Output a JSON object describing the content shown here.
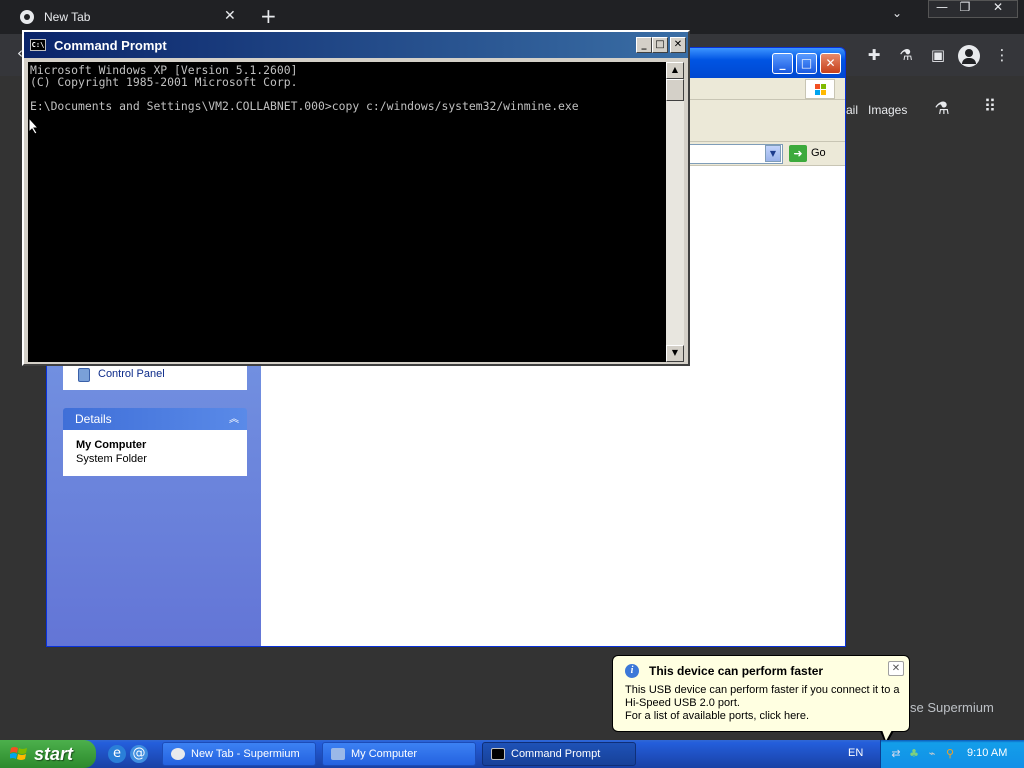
{
  "chrome": {
    "tab_title": "New Tab",
    "tab_close": "✕",
    "new_tab": "+",
    "tab_menu": "⌄",
    "minimize": "—",
    "restore": "❐",
    "close": "✕",
    "toolbar": {
      "gmail_partial": "ail",
      "images": "Images",
      "ext_icon": "puzzle-icon",
      "lab_icon": "flask-icon",
      "sidepanel_icon": "side-panel-icon",
      "profile_icon": "profile-icon",
      "menu_icon": "⋮"
    },
    "customize_partial": "se Supermium"
  },
  "my_computer": {
    "panel_item_control_panel": "Control Panel",
    "details_header": "Details",
    "details_title": "My Computer",
    "details_subtitle": "System Folder",
    "go_label": "Go",
    "window_min": "_",
    "window_max": "□",
    "window_close": "✕"
  },
  "cmd": {
    "title": "Command Prompt",
    "icon_text": "C:\\",
    "min": "_",
    "max": "□",
    "close": "✕",
    "line1": "Microsoft Windows XP [Version 5.1.2600]",
    "line2": "(C) Copyright 1985-2001 Microsoft Corp.",
    "line3": "",
    "line4": "E:\\Documents and Settings\\VM2.COLLABNET.000>copy c:/windows/system32/winmine.exe"
  },
  "balloon": {
    "title": "This device can perform faster",
    "body_line1": "This USB device can perform faster if you connect it to a",
    "body_line2": "Hi-Speed USB 2.0 port.",
    "body_line3": "For a list of available ports, click here.",
    "close": "✕",
    "info": "i"
  },
  "taskbar": {
    "start": "start",
    "tasks": [
      {
        "label": "New Tab - Supermium"
      },
      {
        "label": "My Computer"
      },
      {
        "label": "Command Prompt"
      }
    ],
    "lang": "EN",
    "time": "9:10 AM"
  },
  "colors": {
    "xp_blue": "#245edb",
    "start_green": "#3c9d3c",
    "console_bg": "#000000",
    "console_fg": "#c0c0c0",
    "balloon_bg": "#ffffe1"
  }
}
